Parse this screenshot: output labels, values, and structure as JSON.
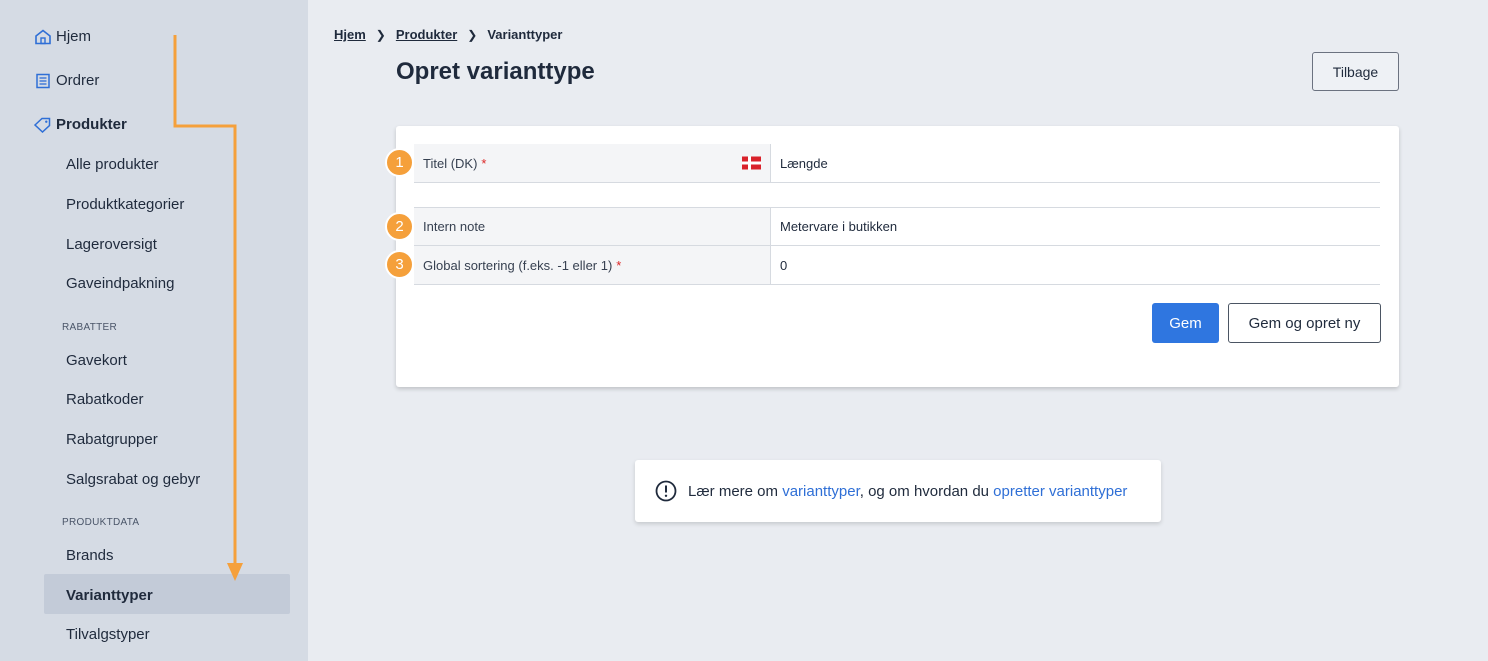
{
  "sidebar": {
    "top_items": [
      {
        "label": "Hjem",
        "icon": "home-icon"
      },
      {
        "label": "Ordrer",
        "icon": "orders-icon"
      },
      {
        "label": "Produkter",
        "icon": "tag-icon"
      }
    ],
    "product_items": [
      "Alle produkter",
      "Produktkategorier",
      "Lageroversigt",
      "Gaveindpakning"
    ],
    "section_discounts": "RABATTER",
    "discount_items": [
      "Gavekort",
      "Rabatkoder",
      "Rabatgrupper",
      "Salgsrabat og gebyr"
    ],
    "section_productdata": "PRODUKTDATA",
    "productdata_items": [
      "Brands",
      "Varianttyper",
      "Tilvalgstyper"
    ],
    "active_item": "Varianttyper"
  },
  "breadcrumb": {
    "items": [
      "Hjem",
      "Produkter"
    ],
    "current": "Varianttyper"
  },
  "page_title": "Opret varianttype",
  "back_button": "Tilbage",
  "form": {
    "fields": [
      {
        "badge": "1",
        "label": "Titel (DK)",
        "required": "*",
        "value": "Længde",
        "flag": "flag-dk-icon"
      },
      {
        "badge": "2",
        "label": "Intern note",
        "required": "",
        "value": "Metervare i butikken"
      },
      {
        "badge": "3",
        "label": "Global sortering (f.eks. -1 eller 1)",
        "required": "*",
        "value": "0"
      }
    ],
    "save_label": "Gem",
    "save_new_label": "Gem og opret ny"
  },
  "info": {
    "prefix": "Lær mere om ",
    "link1": "varianttyper",
    "middle": ", og om hvordan du ",
    "link2": "opretter varianttyper"
  },
  "colors": {
    "accent": "#2f76e0",
    "annotation": "#f5a03b",
    "sidebar_bg": "#d5dbe4"
  }
}
